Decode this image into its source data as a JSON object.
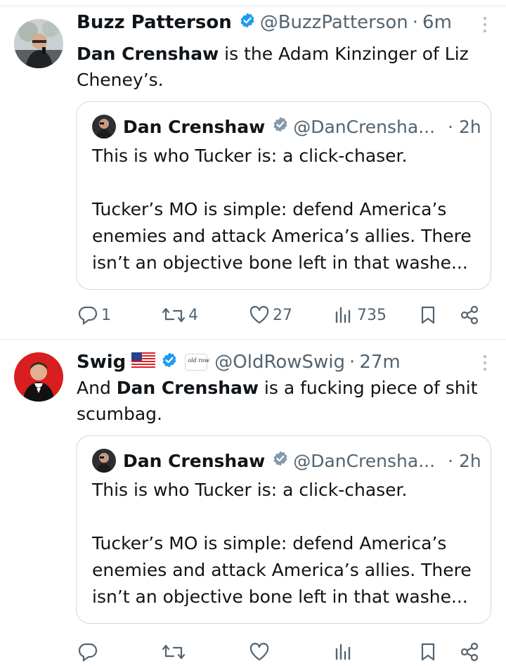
{
  "tweets": [
    {
      "author": "Buzz Patterson",
      "handle": "@BuzzPatterson",
      "time": "6m",
      "text_bold": "Dan Crenshaw",
      "text_rest": " is the Adam Kinzinger of Liz Cheney’s.",
      "quote": {
        "author": "Dan Crenshaw",
        "handle": "@DanCrensha...",
        "time": "· 2h",
        "line1": "This is who Tucker is: a click-chaser.",
        "line2": "Tucker’s MO is simple: defend America’s enemies and attack America’s allies. There isn’t an objective bone left in that washe..."
      },
      "actions": {
        "replies": "1",
        "reposts": "4",
        "likes": "27",
        "views": "735"
      }
    },
    {
      "author": "Swig",
      "handle": "@OldRowSwig",
      "time": "27m",
      "text_bold": "Dan Crenshaw",
      "text_pre": "And ",
      "text_rest": " is a fucking piece of shit scumbag.",
      "quote": {
        "author": "Dan Crenshaw",
        "handle": "@DanCrensha...",
        "time": "· 2h",
        "line1": "This is who Tucker is: a click-chaser.",
        "line2": "Tucker’s MO is simple: defend America’s enemies and attack America’s allies. There isn’t an objective bone left in that washe..."
      }
    }
  ],
  "icons": {
    "verified": "verified-badge-icon",
    "more": "more-dots-icon",
    "reply": "reply-icon",
    "repost": "repost-icon",
    "like": "like-icon",
    "views": "views-icon",
    "bookmark": "bookmark-icon",
    "share": "share-icon"
  },
  "colors": {
    "verified_blue": "#1d9bf0",
    "muted": "#536471"
  }
}
